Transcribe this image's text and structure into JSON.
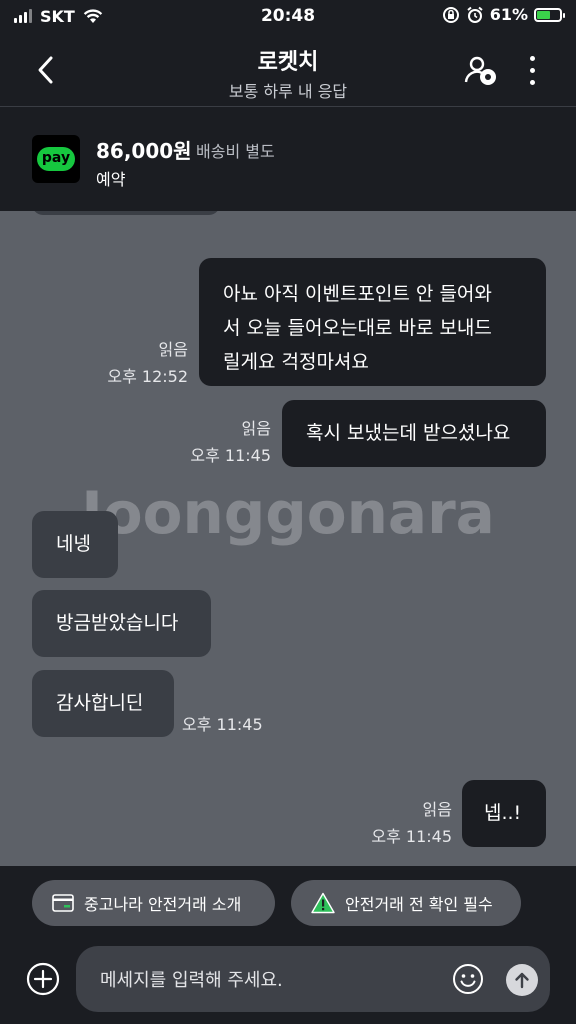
{
  "status_bar": {
    "carrier": "SKT",
    "time": "20:48",
    "battery": "61%",
    "battery_level": 0.61
  },
  "header": {
    "title": "로켓치",
    "subtitle": "보통 하루 내 응답"
  },
  "product": {
    "price": "86,000원",
    "shipping": "배송비 별도",
    "status": "예약",
    "pay_logo_text": "pay",
    "brand_color": "#16c73f"
  },
  "watermark": "Joonggonara",
  "messages": [
    {
      "side": "mine",
      "lines": [
        "아뇨 아직 이벤트포인트 안 들어와",
        "서 오늘  들어오는대로 바로 보내드",
        "릴게요 걱정마셔요"
      ],
      "read": "읽음",
      "time": "오후 12:52"
    },
    {
      "side": "mine",
      "lines": [
        "혹시 보냈는데 받으셨나요"
      ],
      "read": "읽음",
      "time": "오후 11:45"
    },
    {
      "side": "theirs",
      "lines": [
        "네넹"
      ]
    },
    {
      "side": "theirs",
      "lines": [
        "방금받았습니다"
      ]
    },
    {
      "side": "theirs",
      "lines": [
        "감사합니딘"
      ],
      "time": "오후 11:45"
    },
    {
      "side": "mine",
      "lines": [
        "넵..!"
      ],
      "read": "읽음",
      "time": "오후 11:45"
    }
  ],
  "chips": [
    {
      "label": "중고나라 안전거래 소개",
      "icon": "card-icon"
    },
    {
      "label": "안전거래 전 확인 필수",
      "icon": "warning-icon"
    }
  ],
  "input": {
    "placeholder": "메세지를 입력해 주세요."
  }
}
